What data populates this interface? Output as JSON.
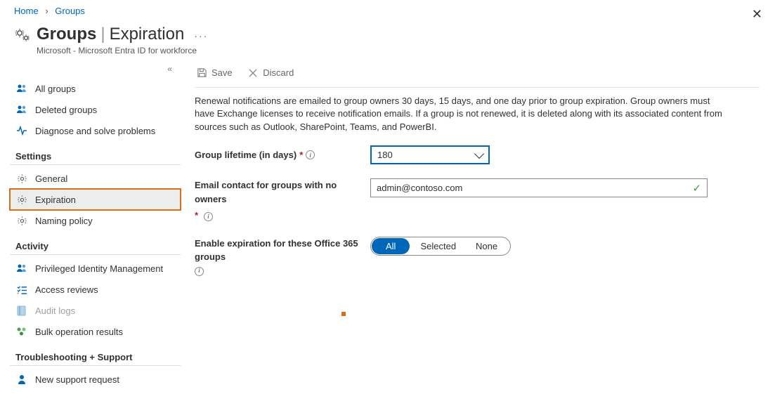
{
  "breadcrumb": {
    "home": "Home",
    "groups": "Groups"
  },
  "header": {
    "title_bold": "Groups",
    "title_light": "Expiration",
    "subtitle": "Microsoft - Microsoft Entra ID for workforce"
  },
  "sidebar": {
    "items": [
      {
        "label": "All groups",
        "icon": "users"
      },
      {
        "label": "Deleted groups",
        "icon": "users"
      },
      {
        "label": "Diagnose and solve problems",
        "icon": "pulse"
      }
    ],
    "settings_h": "Settings",
    "settings": [
      {
        "label": "General",
        "icon": "gear"
      },
      {
        "label": "Expiration",
        "icon": "gear",
        "selected": true
      },
      {
        "label": "Naming policy",
        "icon": "gear"
      }
    ],
    "activity_h": "Activity",
    "activity": [
      {
        "label": "Privileged Identity Management",
        "icon": "users"
      },
      {
        "label": "Access reviews",
        "icon": "checklist"
      },
      {
        "label": "Audit logs",
        "icon": "book",
        "disabled": true
      },
      {
        "label": "Bulk operation results",
        "icon": "bulk"
      }
    ],
    "trouble_h": "Troubleshooting + Support",
    "trouble": [
      {
        "label": "New support request",
        "icon": "person"
      }
    ]
  },
  "cmdbar": {
    "save": "Save",
    "discard": "Discard"
  },
  "notice": "Renewal notifications are emailed to group owners 30 days, 15 days, and one day prior to group expiration. Group owners must have Exchange licenses to receive notification emails. If a group is not renewed, it is deleted along with its associated content from sources such as Outlook, SharePoint, Teams, and PowerBI.",
  "form": {
    "lifetime_label": "Group lifetime (in days)",
    "lifetime_value": "180",
    "email_label": "Email contact for groups with no owners",
    "email_value": "admin@contoso.com",
    "enable_label": "Enable expiration for these Office 365 groups",
    "seg_all": "All",
    "seg_selected": "Selected",
    "seg_none": "None"
  }
}
